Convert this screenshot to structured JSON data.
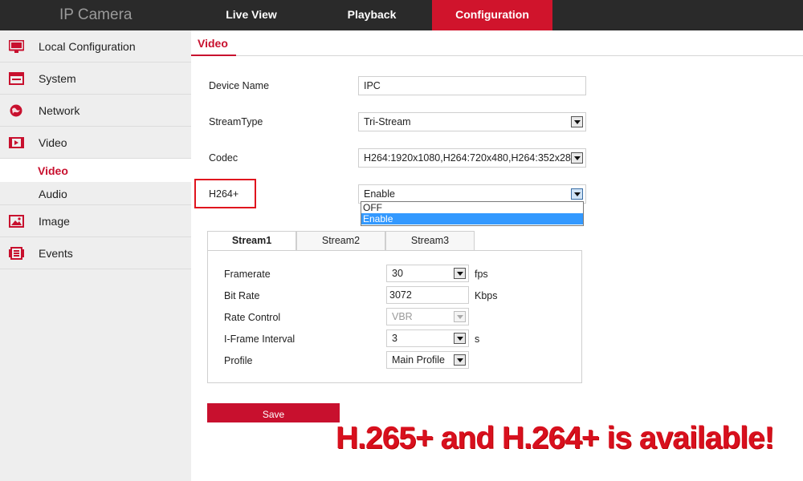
{
  "app": {
    "brand": "IP Camera"
  },
  "nav": {
    "live_view": "Live View",
    "playback": "Playback",
    "configuration": "Configuration"
  },
  "sidebar": {
    "items": [
      {
        "label": "Local Configuration",
        "icon": "monitor-icon"
      },
      {
        "label": "System",
        "icon": "system-icon"
      },
      {
        "label": "Network",
        "icon": "globe-icon"
      },
      {
        "label": "Video",
        "icon": "video-icon"
      },
      {
        "label": "Image",
        "icon": "image-icon"
      },
      {
        "label": "Events",
        "icon": "events-icon"
      }
    ],
    "video_sub": [
      {
        "label": "Video",
        "active": true
      },
      {
        "label": "Audio",
        "active": false
      }
    ]
  },
  "page": {
    "title": "Video"
  },
  "form": {
    "device_name_label": "Device Name",
    "device_name_value": "IPC",
    "stream_type_label": "StreamType",
    "stream_type_value": "Tri-Stream",
    "codec_label": "Codec",
    "codec_value": "H264:1920x1080,H264:720x480,H264:352x288",
    "h264plus_label": "H264+",
    "h264plus_value": "Enable",
    "h264plus_options": [
      "OFF",
      "Enable"
    ]
  },
  "stream_tabs": [
    "Stream1",
    "Stream2",
    "Stream3"
  ],
  "stream1": {
    "framerate_label": "Framerate",
    "framerate_value": "30",
    "framerate_unit": "fps",
    "bitrate_label": "Bit Rate",
    "bitrate_value": "3072",
    "bitrate_unit": "Kbps",
    "rate_control_label": "Rate Control",
    "rate_control_value": "VBR",
    "iframe_label": "I-Frame Interval",
    "iframe_value": "3",
    "iframe_unit": "s",
    "profile_label": "Profile",
    "profile_value": "Main Profile"
  },
  "save_label": "Save",
  "promo_text": "H.265+ and H.264+ is available!",
  "colors": {
    "accent": "#c8102e",
    "topbar": "#2a2a2a",
    "sidebar": "#eeeeee",
    "selection": "#3399ff"
  }
}
